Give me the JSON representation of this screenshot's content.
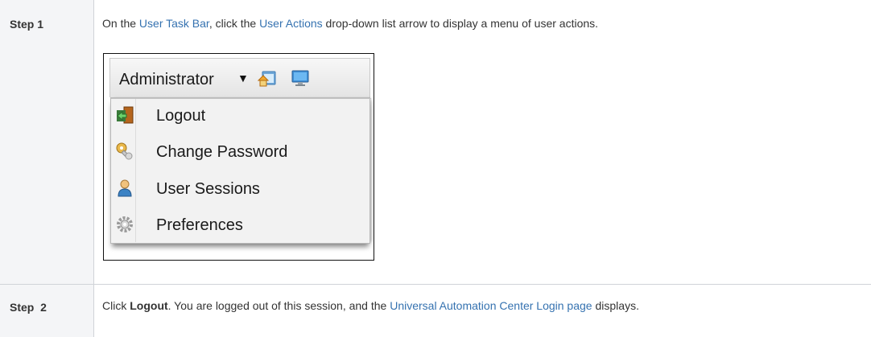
{
  "step1": {
    "label": "Step 1",
    "text_before": "On the ",
    "link1": "User Task Bar",
    "text_mid": ", click the ",
    "link2": "User Actions",
    "text_after": " drop-down list arrow to display a menu of user actions."
  },
  "screenshot": {
    "taskbar": {
      "user_label": "Administrator",
      "arrow_glyph": "▼",
      "icons": [
        "home-page-icon",
        "desktop-monitor-icon"
      ]
    },
    "menu": [
      {
        "label": "Logout",
        "icon": "logout-door-icon"
      },
      {
        "label": "Change Password",
        "icon": "key-icon"
      },
      {
        "label": "User Sessions",
        "icon": "user-icon"
      },
      {
        "label": "Preferences",
        "icon": "gear-icon"
      }
    ]
  },
  "step2": {
    "label": "Step  2",
    "text_before": "Click ",
    "bold": "Logout",
    "text_mid": ". You are logged out of this session, and the ",
    "link": "Universal Automation Center Login page",
    "text_after": " displays."
  },
  "colors": {
    "link": "#3572b0",
    "header_bg": "#f4f5f7",
    "border": "#d0d3d8"
  }
}
